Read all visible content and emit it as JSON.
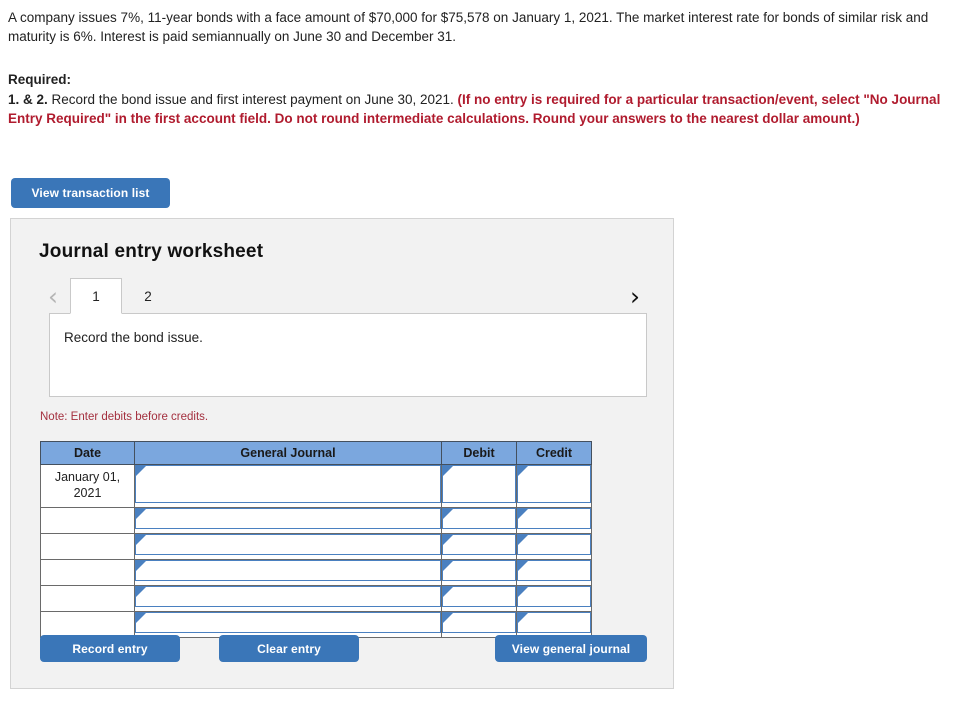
{
  "problem": {
    "statement": "A company issues 7%, 11-year bonds with a face amount of $70,000 for $75,578 on January 1, 2021. The market interest rate for bonds of similar risk and maturity is 6%. Interest is paid semiannually on June 30 and December 31."
  },
  "required": {
    "label": "Required:",
    "item_number": "1. & 2.",
    "item_text": " Record the bond issue and first interest payment on June 30, 2021. ",
    "item_note": "(If no entry is required for a particular transaction/event, select \"No Journal Entry Required\" in the first account field. Do not round intermediate calculations. Round your answers to the nearest dollar amount.)"
  },
  "toolbar": {
    "view_transaction_list": "View transaction list"
  },
  "worksheet": {
    "title": "Journal entry worksheet",
    "prev_icon": "chevron-left-icon",
    "next_icon": "chevron-right-icon",
    "tabs": [
      {
        "label": "1",
        "active": true
      },
      {
        "label": "2",
        "active": false
      }
    ],
    "description": "Record the bond issue.",
    "note": "Note: Enter debits before credits."
  },
  "table": {
    "headers": [
      "Date",
      "General Journal",
      "Debit",
      "Credit"
    ],
    "rows": [
      {
        "date": "January 01, 2021",
        "general_journal": "",
        "debit": "",
        "credit": ""
      },
      {
        "date": "",
        "general_journal": "",
        "debit": "",
        "credit": ""
      },
      {
        "date": "",
        "general_journal": "",
        "debit": "",
        "credit": ""
      },
      {
        "date": "",
        "general_journal": "",
        "debit": "",
        "credit": ""
      },
      {
        "date": "",
        "general_journal": "",
        "debit": "",
        "credit": ""
      },
      {
        "date": "",
        "general_journal": "",
        "debit": "",
        "credit": ""
      }
    ]
  },
  "actions": {
    "record_entry": "Record entry",
    "clear_entry": "Clear entry",
    "view_general_journal": "View general journal"
  },
  "colors": {
    "button_blue": "#3a76b8",
    "table_header_blue": "#7ba7de",
    "cell_border_blue": "#4a80c0",
    "alert_red": "#b01b2e",
    "note_red": "#a4303f",
    "panel_gray": "#f2f2f2"
  }
}
